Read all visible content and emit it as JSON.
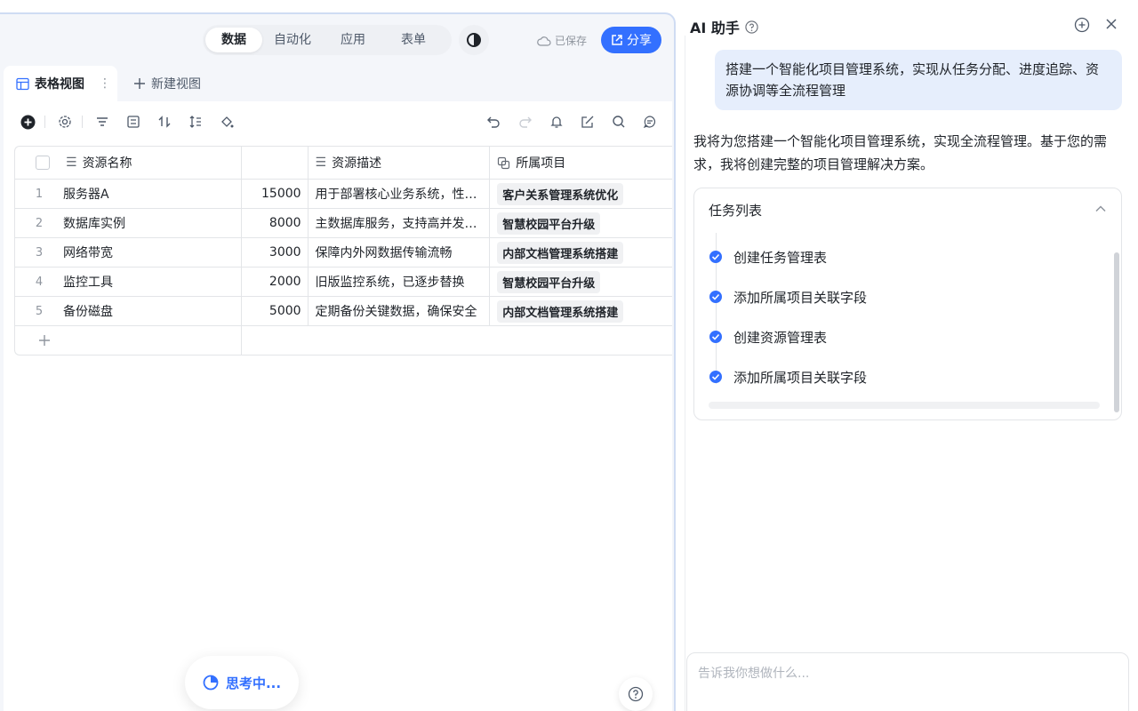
{
  "topbar": {
    "tabs": [
      {
        "label": "数据",
        "active": true
      },
      {
        "label": "自动化",
        "active": false
      },
      {
        "label": "应用",
        "active": false
      },
      {
        "label": "表单",
        "active": false
      }
    ],
    "saved_label": "已保存",
    "share_label": "分享"
  },
  "views": {
    "current": "表格视图",
    "new_view": "新建视图"
  },
  "grid": {
    "columns": [
      {
        "label": "资源名称",
        "icon": "text-field-icon"
      },
      {
        "label": "",
        "icon": ""
      },
      {
        "label": "资源描述",
        "icon": "text-field-icon"
      },
      {
        "label": "所属项目",
        "icon": "link-field-icon"
      }
    ],
    "rows": [
      {
        "num": "1",
        "name": "服务器A",
        "amount": "15000",
        "desc": "用于部署核心业务系统，性…",
        "project": "客户关系管理系统优化"
      },
      {
        "num": "2",
        "name": "数据库实例",
        "amount": "8000",
        "desc": "主数据库服务，支持高并发…",
        "project": "智慧校园平台升级"
      },
      {
        "num": "3",
        "name": "网络带宽",
        "amount": "3000",
        "desc": "保障内外网数据传输流畅",
        "project": "内部文档管理系统搭建"
      },
      {
        "num": "4",
        "name": "监控工具",
        "amount": "2000",
        "desc": "旧版监控系统，已逐步替换",
        "project": "智慧校园平台升级"
      },
      {
        "num": "5",
        "name": "备份磁盘",
        "amount": "5000",
        "desc": "定期备份关键数据，确保安全",
        "project": "内部文档管理系统搭建"
      }
    ]
  },
  "thinking_label": "思考中...",
  "assistant": {
    "title": "AI 助手",
    "user_message": "搭建一个智能化项目管理系统，实现从任务分配、进度追踪、资源协调等全流程管理",
    "ai_message": "我将为您搭建一个智能化项目管理系统，实现全流程管理。基于您的需求，我将创建完整的项目管理解决方案。",
    "task_list_title": "任务列表",
    "tasks": [
      "创建任务管理表",
      "添加所属项目关联字段",
      "创建资源管理表",
      "添加所属项目关联字段"
    ],
    "input_placeholder": "告诉我你想做什么..."
  },
  "colors": {
    "accent": "#3370ff",
    "user_bubble": "#e6eefc"
  }
}
